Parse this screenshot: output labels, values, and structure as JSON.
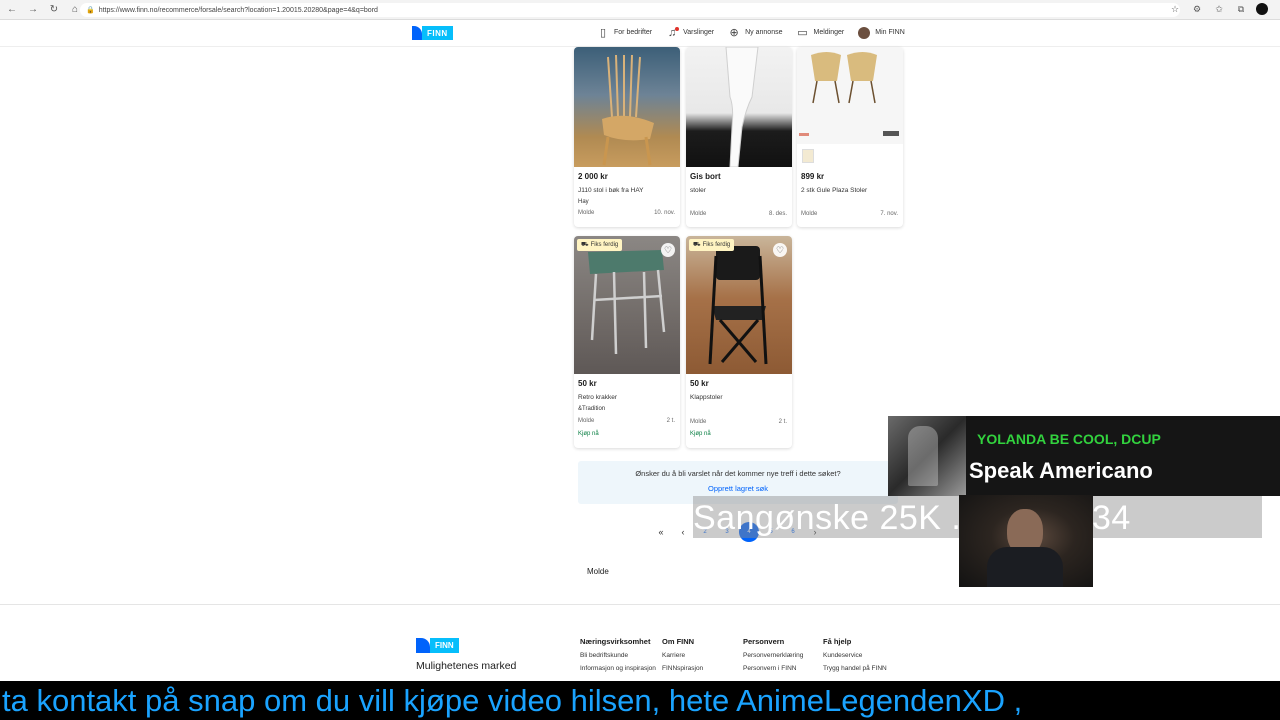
{
  "browser": {
    "url": "https://www.finn.no/recommerce/forsale/search?location=1.20015.20280&page=4&q=bord"
  },
  "header": {
    "logo_text": "FINN",
    "nav": [
      {
        "label": "For bedrifter",
        "icon": "building-icon"
      },
      {
        "label": "Varslinger",
        "icon": "bell-icon"
      },
      {
        "label": "Ny annonse",
        "icon": "plus-circle-icon"
      },
      {
        "label": "Meldinger",
        "icon": "chat-icon"
      },
      {
        "label": "Min FINN",
        "icon": "avatar"
      }
    ]
  },
  "listings": [
    {
      "price": "2 000 kr",
      "title": "J110 stol i bøk fra HAY",
      "brand": "Hay",
      "location": "Molde",
      "time": "10. nov.",
      "badge": "",
      "buy": ""
    },
    {
      "price": "Gis bort",
      "title": "stoler",
      "brand": "",
      "location": "Molde",
      "time": "8. des.",
      "badge": "",
      "buy": ""
    },
    {
      "price": "899 kr",
      "title": "2 stk Gule Plaza Stoler",
      "brand": "",
      "location": "Molde",
      "time": "7. nov.",
      "badge": "",
      "buy": ""
    },
    {
      "price": "50 kr",
      "title": "Retro krakker",
      "brand": "&Tradition",
      "location": "Molde",
      "time": "2 t.",
      "badge": "Fiks ferdig",
      "buy": "Kjøp nå"
    },
    {
      "price": "50 kr",
      "title": "Klappstoler",
      "brand": "",
      "location": "Molde",
      "time": "2 t.",
      "badge": "Fiks ferdig",
      "buy": "Kjøp nå"
    }
  ],
  "saved_search": {
    "question": "Ønsker du å bli varslet når det kommer nye treff i dette søket?",
    "link": "Opprett lagret søk"
  },
  "pagination": {
    "first": "«",
    "prev": "‹",
    "pages": [
      "2",
      "3",
      "4",
      "5",
      "6"
    ],
    "current": "4",
    "next": "›"
  },
  "location_label": "Molde",
  "footer": {
    "logo_text": "FINN",
    "tagline": "Mulighetenes marked",
    "columns": [
      {
        "heading": "Næringsvirksomhet",
        "links": [
          "Bli bedriftskunde",
          "Informasjon og inspirasjon"
        ]
      },
      {
        "heading": "Om FINN",
        "links": [
          "Karriere",
          "FINNspirasjon"
        ]
      },
      {
        "heading": "Personvern",
        "links": [
          "Personvernerklæring",
          "Personvern i FINN"
        ]
      },
      {
        "heading": "Få hjelp",
        "links": [
          "Kundeservice",
          "Trygg handel på FINN"
        ]
      }
    ]
  },
  "overlay": {
    "artist": "YOLANDA BE COOL, DCUP",
    "song": "Speak Americano",
    "alert": "Sangønske 25K   ...S 927834",
    "ticker": "ta kontakt  på snap om du vill kjøpe video  hilsen, hete AnimeLegendenXD ,"
  }
}
